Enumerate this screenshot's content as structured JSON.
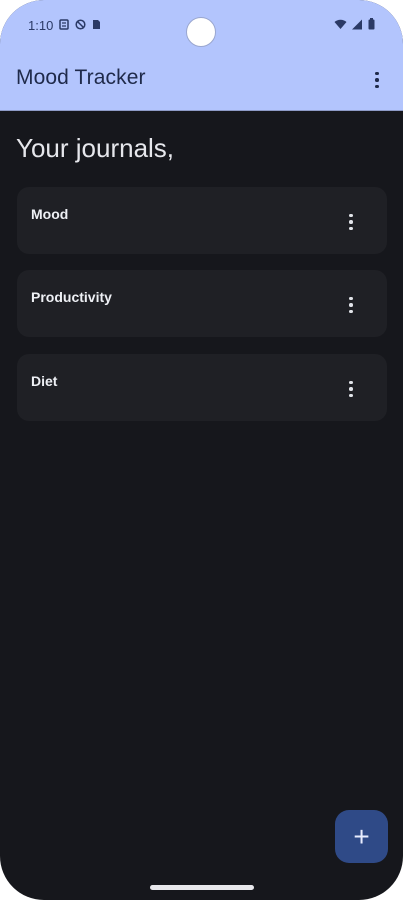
{
  "status_bar": {
    "time": "1:10",
    "icons": [
      "notification-icon",
      "vpn-icon",
      "sim-icon",
      "wifi-icon",
      "signal-icon",
      "battery-icon"
    ]
  },
  "app_bar": {
    "title": "Mood Tracker",
    "menu_icon": "more-vert-icon"
  },
  "main": {
    "heading": "Your journals,",
    "journals": [
      {
        "title": "Mood"
      },
      {
        "title": "Productivity"
      },
      {
        "title": "Diet"
      }
    ]
  },
  "fab": {
    "label": "+"
  },
  "colors": {
    "app_bar_bg": "#b3c5fd",
    "background": "#16171c",
    "card_bg": "#1f2025",
    "fab_bg": "#2f4a87"
  }
}
